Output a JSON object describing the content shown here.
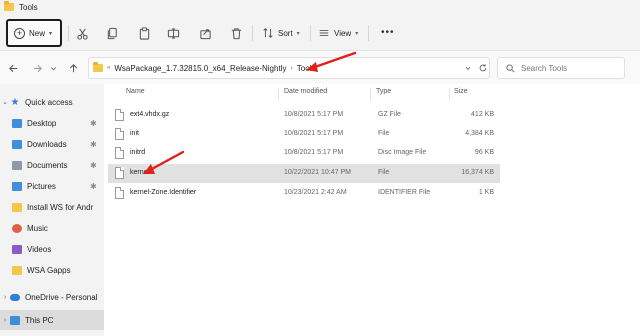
{
  "window": {
    "title": "Tools"
  },
  "command_bar": {
    "new_label": "New",
    "sort_label": "Sort",
    "view_label": "View",
    "more_label": "•••",
    "icons": [
      "cut-icon",
      "copy-icon",
      "paste-icon",
      "rename-icon",
      "share-icon",
      "delete-icon",
      "sort-icon",
      "view-icon"
    ]
  },
  "address_bar": {
    "overflow_label": "«",
    "crumbs": [
      "WsaPackage_1.7.32815.0_x64_Release-Nightly",
      "Tools"
    ],
    "search_placeholder": "Search Tools"
  },
  "nav_pane": {
    "items": [
      {
        "label": "Quick access",
        "icon": "star-icon",
        "color": "#3a7bd5"
      },
      {
        "label": "Desktop",
        "icon": "desktop-icon",
        "color": "#3f8fdc"
      },
      {
        "label": "Downloads",
        "icon": "downloads-icon",
        "color": "#3f8fdc"
      },
      {
        "label": "Documents",
        "icon": "documents-icon",
        "color": "#8a9aa8"
      },
      {
        "label": "Pictures",
        "icon": "pictures-icon",
        "color": "#3f8fdc"
      },
      {
        "label": "Install WS for Andr",
        "icon": "folder-icon",
        "color": "#f4c64a"
      },
      {
        "label": "Music",
        "icon": "music-icon",
        "color": "#e0604a"
      },
      {
        "label": "Videos",
        "icon": "videos-icon",
        "color": "#8a5cc8"
      },
      {
        "label": "WSA Gapps",
        "icon": "folder-icon",
        "color": "#f4c64a"
      },
      {
        "label": "OneDrive - Personal",
        "icon": "onedrive-icon",
        "color": "#2f7fd9"
      },
      {
        "label": "This PC",
        "icon": "pc-icon",
        "color": "#3a8fd8"
      }
    ]
  },
  "file_list": {
    "columns": {
      "name": "Name",
      "date": "Date modified",
      "type": "Type",
      "size": "Size"
    },
    "rows": [
      {
        "name": "ext4.vhdx.gz",
        "date": "10/8/2021 5:17 PM",
        "type": "GZ File",
        "size": "412 KB"
      },
      {
        "name": "init",
        "date": "10/8/2021 5:17 PM",
        "type": "File",
        "size": "4,384 KB"
      },
      {
        "name": "initrd",
        "date": "10/8/2021 5:17 PM",
        "type": "Disc Image File",
        "size": "96 KB"
      },
      {
        "name": "kernel",
        "date": "10/22/2021 10:47 PM",
        "type": "File",
        "size": "16,374 KB"
      },
      {
        "name": "kernel-Zone.Identifier",
        "date": "10/23/2021 2:42 AM",
        "type": "IDENTIFIER File",
        "size": "1 KB"
      }
    ],
    "selected_index": 3
  },
  "colors": {
    "arrow": "#e0201a",
    "selected_row": "#e1e1e1",
    "focus_border": "#1c1c1c"
  }
}
